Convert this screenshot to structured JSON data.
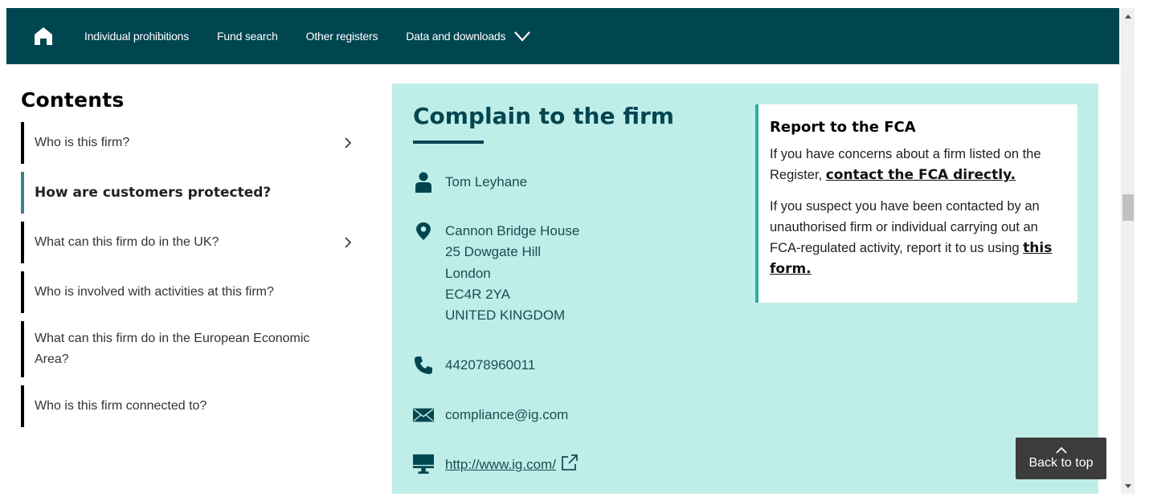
{
  "nav": {
    "home_icon": "home-icon",
    "links": [
      {
        "label": "Individual prohibitions"
      },
      {
        "label": "Fund search"
      },
      {
        "label": "Other registers"
      },
      {
        "label": "Data and downloads",
        "has_dropdown": true
      }
    ]
  },
  "contents": {
    "title": "Contents",
    "items": [
      {
        "label": "Who is this firm?",
        "has_chevron": true,
        "active": false
      },
      {
        "label": "How are customers protected?",
        "has_chevron": false,
        "active": true
      },
      {
        "label": "What can this firm do in the UK?",
        "has_chevron": true,
        "active": false
      },
      {
        "label": "Who is involved with activities at this firm?",
        "has_chevron": false,
        "active": false
      },
      {
        "label": "What can this firm do in the European Economic Area?",
        "has_chevron": false,
        "active": false
      },
      {
        "label": "Who is this firm connected to?",
        "has_chevron": false,
        "active": false
      }
    ]
  },
  "complain": {
    "title": "Complain to the firm",
    "contact_name": "Tom Leyhane",
    "address": [
      "Cannon Bridge House",
      "25 Dowgate Hill",
      "London",
      "EC4R 2YA",
      "UNITED KINGDOM"
    ],
    "phone": "442078960011",
    "email": "compliance@ig.com",
    "website": "http://www.ig.com/"
  },
  "report": {
    "title": "Report to the FCA",
    "p1_text": "If you have concerns about a firm listed on the Register, ",
    "p1_link": "contact the FCA directly.",
    "p2_text": "If you suspect you have been contacted by an unauthorised firm or individual carrying out an FCA-regulated activity, report it to us using ",
    "p2_link": "this form."
  },
  "back_to_top": {
    "label": "Back to top"
  },
  "colors": {
    "nav_bg": "#004651",
    "panel_bg": "#bfeee9",
    "accent_teal": "#25b0a5",
    "active_border": "#3f8189",
    "back_to_top_bg": "#3c3c3c"
  }
}
